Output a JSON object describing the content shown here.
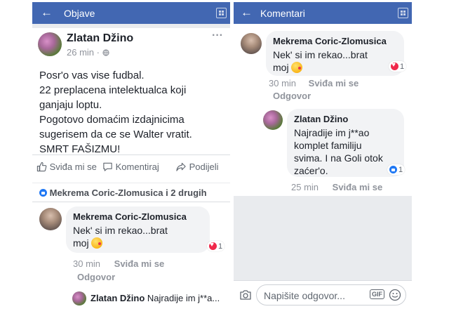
{
  "left": {
    "topbar": {
      "back": "←",
      "title": "Objave",
      "back_icon": "arrow-left-icon",
      "grid_icon": "grid-icon"
    },
    "post": {
      "author": "Zlatan Džino",
      "time": "26 min",
      "audience_icon": "globe-icon",
      "more": "···",
      "lines": [
        "Posr'o vas vise fudbal.",
        "22 preplacena intelektualca koji",
        "ganjaju loptu.",
        "Pogotovo domaćim izdajnicima",
        "sugerisem da ce se Walter vratit.",
        "SMRT FAŠIZMU!"
      ]
    },
    "actions": {
      "like": "Sviđa mi se",
      "comment": "Komentiraj",
      "share": "Podijeli"
    },
    "reactions": "Mekrema Coric-Zlomusica i 2 drugih",
    "comment": {
      "name": "Mekrema Coric-Zlomusica",
      "line1": "Nek' si im rekao...brat",
      "line2": "moj",
      "react_count": "1",
      "time": "30 min",
      "like": "Sviđa mi se",
      "reply": "Odgovor"
    },
    "reply_preview": {
      "name": "Zlatan Džino",
      "text": "Najradije im j**a..."
    }
  },
  "right": {
    "topbar": {
      "back": "←",
      "title": "Komentari",
      "back_icon": "arrow-left-icon",
      "grid_icon": "grid-icon"
    },
    "comment": {
      "name": "Mekrema Coric-Zlomusica",
      "line1": "Nek' si im rekao...brat",
      "line2": "moj",
      "react_count": "1",
      "time": "30 min",
      "like": "Sviđa mi se",
      "reply": "Odgovor"
    },
    "reply": {
      "name": "Zlatan Džino",
      "lines": [
        "Najradije im j**ao",
        "komplet familiju",
        "svima. I na Goli otok",
        "zaćer'o."
      ],
      "react_count": "1",
      "time": "25 min",
      "like": "Sviđa mi se"
    },
    "composer": {
      "placeholder": "Napišite odgovor...",
      "gif": "GIF",
      "camera_icon": "camera-icon",
      "smiley_icon": "smiley-icon"
    }
  },
  "colors": {
    "brand": "#4267b2",
    "background": "#e9ebee",
    "heart": "#f0284a",
    "like": "#2078f4"
  }
}
